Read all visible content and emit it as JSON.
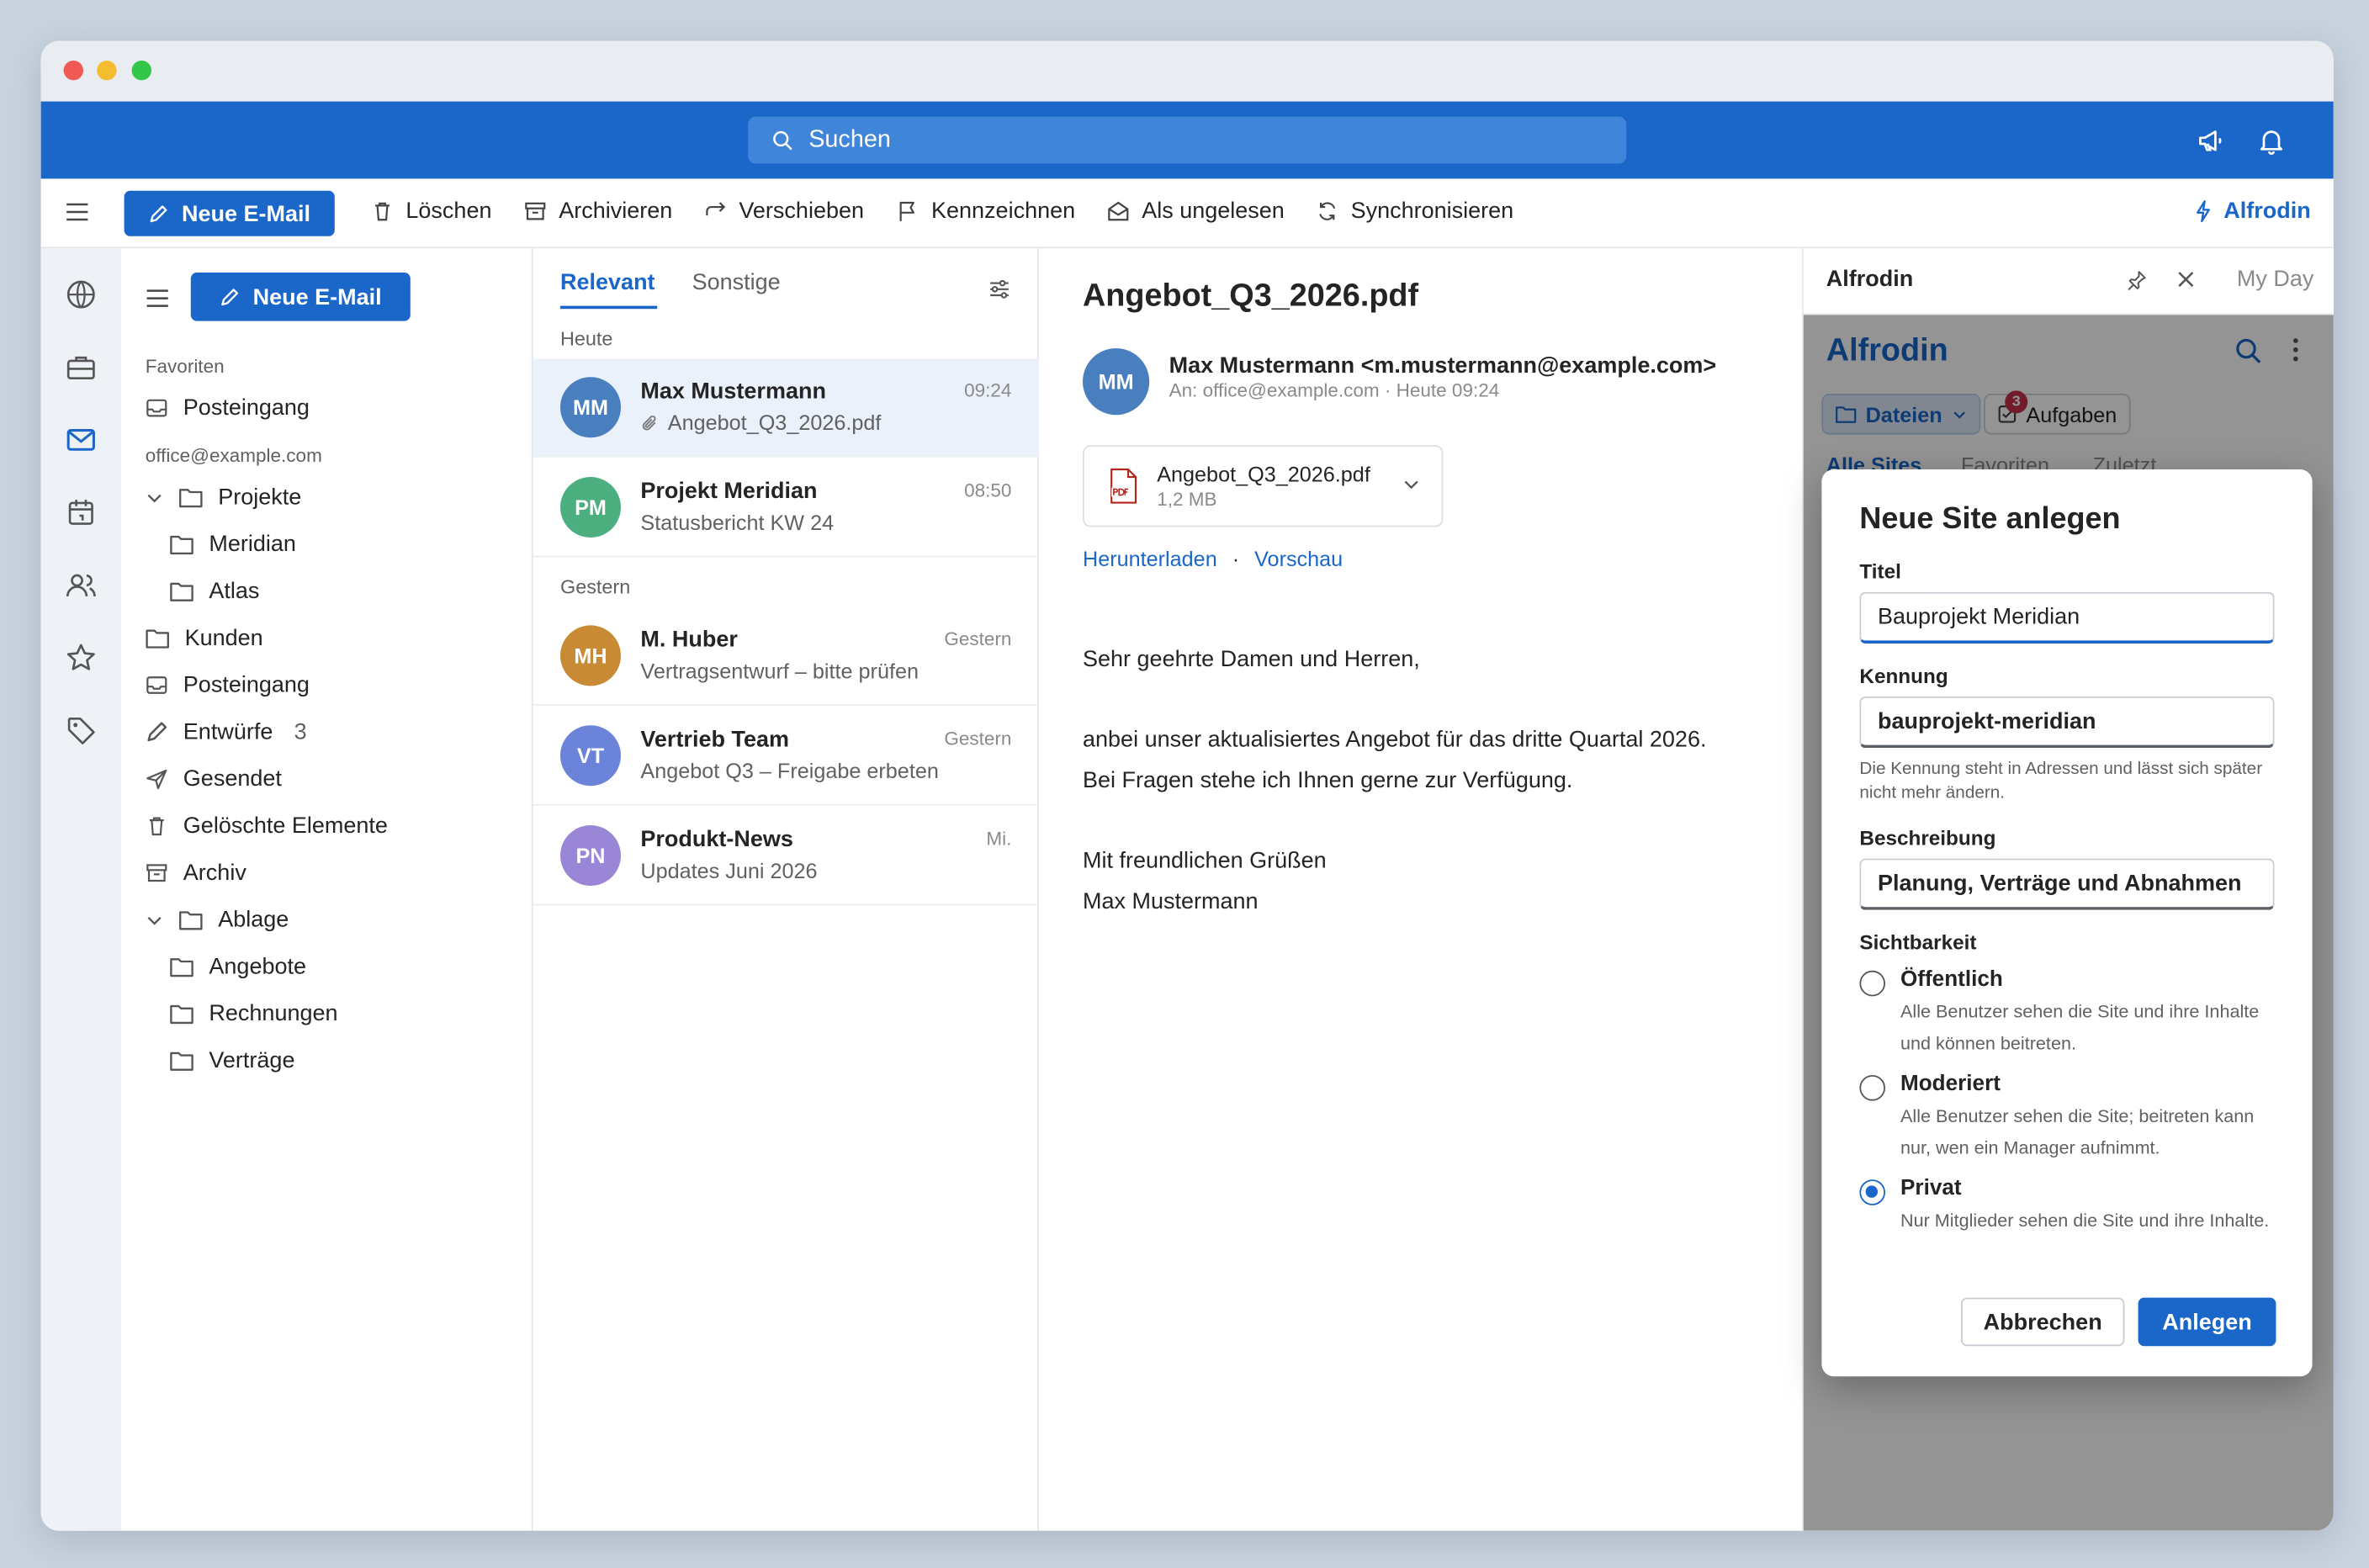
{
  "topbar": {
    "search_placeholder": "Suchen"
  },
  "toolbar": {
    "new_mail": "Neue E-Mail",
    "delete": "Löschen",
    "archive": "Archivieren",
    "move": "Verschieben",
    "flag": "Kennzeichnen",
    "mark_unread": "Als ungelesen",
    "sync": "Synchronisieren",
    "addin": "Alfrodin"
  },
  "folders": {
    "new_mail": "Neue E-Mail",
    "favorites_header": "Favoriten",
    "fav_inbox": "Posteingang",
    "account": "office@example.com",
    "items": [
      {
        "label": "Projekte"
      },
      {
        "label": "Meridian"
      },
      {
        "label": "Atlas"
      },
      {
        "label": "Kunden"
      },
      {
        "label": "Posteingang"
      },
      {
        "label": "Entwürfe",
        "count": "3"
      },
      {
        "label": "Gesendet"
      },
      {
        "label": "Gelöschte Elemente"
      },
      {
        "label": "Archiv"
      },
      {
        "label": "Ablage"
      },
      {
        "label": "Angebote"
      },
      {
        "label": "Rechnungen"
      },
      {
        "label": "Verträge"
      }
    ]
  },
  "list": {
    "tab_relevant": "Relevant",
    "tab_other": "Sonstige",
    "group_today": "Heute",
    "group_yesterday": "Gestern",
    "mails": [
      {
        "initials": "MM",
        "sender": "Max Mustermann",
        "subject": "Angebot_Q3_2026.pdf",
        "time": "09:24",
        "color": "#4a7fbf"
      },
      {
        "initials": "PM",
        "sender": "Projekt Meridian",
        "subject": "Statusbericht KW 24",
        "time": "08:50",
        "color": "#4caf7f"
      },
      {
        "initials": "MH",
        "sender": "M. Huber",
        "subject": "Vertragsentwurf – bitte prüfen",
        "time": "Gestern",
        "color": "#c98a35"
      },
      {
        "initials": "VT",
        "sender": "Vertrieb Team",
        "subject": "Angebot Q3 – Freigabe erbeten",
        "time": "Gestern",
        "color": "#6b83d8"
      },
      {
        "initials": "PN",
        "sender": "Produkt-News",
        "subject": "Updates Juni 2026",
        "time": "Mi.",
        "color": "#9a86d6"
      }
    ]
  },
  "reading": {
    "title": "Angebot_Q3_2026.pdf",
    "avatar": "MM",
    "from": "Max Mustermann <m.mustermann@example.com>",
    "to_line": "An: office@example.com  ·  Heute 09:24",
    "attachment_name": "Angebot_Q3_2026.pdf",
    "attachment_size": "1,2 MB",
    "download": "Herunterladen",
    "link_sep": "·",
    "preview": "Vorschau",
    "body": [
      "Sehr geehrte Damen und Herren,",
      "anbei unser aktualisiertes Angebot für das dritte Quartal 2026.",
      "Bei Fragen stehe ich Ihnen gerne zur Verfügung.",
      "Mit freundlichen Grüßen",
      "Max Mustermann"
    ]
  },
  "addin": {
    "header_title": "Alfrodin",
    "my_day": "My Day",
    "app_title": "Alfrodin",
    "files_pill": "Dateien",
    "tasks_pill": "Aufgaben",
    "tasks_badge": "3",
    "tabs": [
      "Alle Sites",
      "Favoriten",
      "Zuletzt"
    ]
  },
  "modal": {
    "title": "Neue Site anlegen",
    "title_label": "Titel",
    "title_value": "Bauprojekt Meridian",
    "key_label": "Kennung",
    "key_value": "bauprojekt-meridian",
    "key_hint": "Die Kennung steht in Adressen und lässt sich später nicht mehr ändern.",
    "desc_label": "Beschreibung",
    "desc_value": "Planung, Verträge und Abnahmen",
    "visibility_label": "Sichtbarkeit",
    "options": [
      {
        "label": "Öffentlich",
        "desc": "Alle Benutzer sehen die Site und ihre Inhalte und können beitreten.",
        "checked": false
      },
      {
        "label": "Moderiert",
        "desc": "Alle Benutzer sehen die Site; beitreten kann nur, wen ein Manager aufnimmt.",
        "checked": false
      },
      {
        "label": "Privat",
        "desc": "Nur Mitglieder sehen die Site und ihre Inhalte.",
        "checked": true
      }
    ],
    "cancel": "Abbrechen",
    "create": "Anlegen"
  },
  "colors": {
    "accent": "#1a67c9",
    "topbar": "#1a67c9"
  }
}
